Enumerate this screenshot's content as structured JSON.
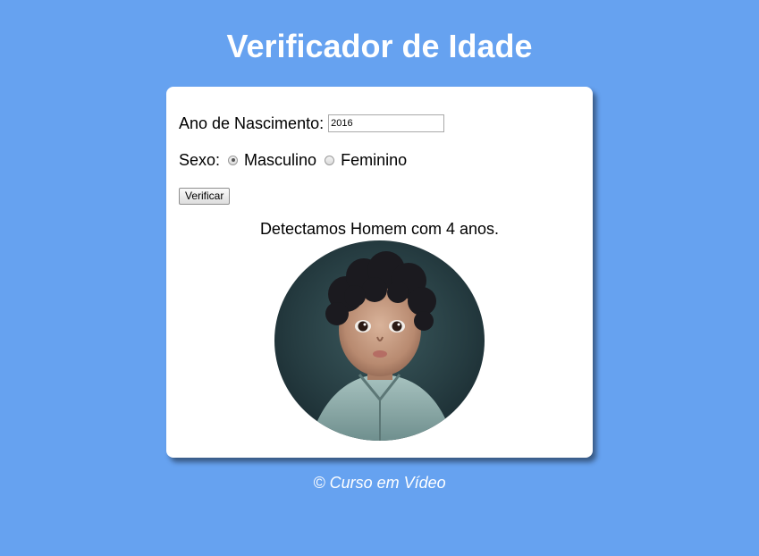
{
  "page": {
    "title": "Verificador de Idade",
    "footer": "© Curso em Vídeo"
  },
  "form": {
    "ano_label": "Ano de Nascimento:",
    "ano_value": "2016",
    "sexo_label": "Sexo:",
    "options": [
      {
        "label": "Masculino",
        "checked": true
      },
      {
        "label": "Feminino",
        "checked": false
      }
    ],
    "button_label": "Verificar"
  },
  "result": {
    "text": "Detectamos Homem com 4 anos.",
    "image_icon": "child-photo"
  },
  "colors": {
    "background": "#66a2f0",
    "card": "#ffffff",
    "text_light": "#ffffff"
  }
}
